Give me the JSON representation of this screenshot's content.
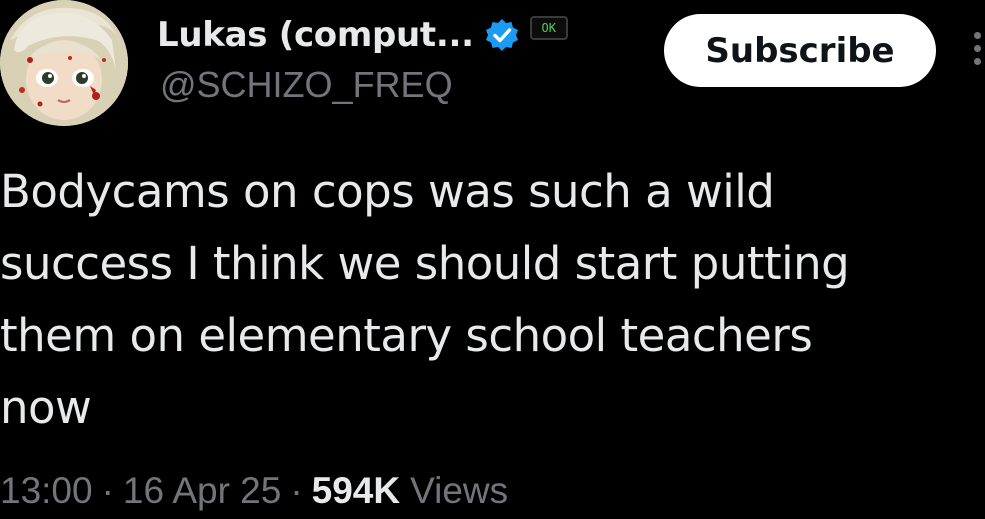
{
  "author": {
    "display_name": "Lukas (comput...",
    "handle": "@SCHIZO_FREQ",
    "badge_verified_icon": "verified-check-icon",
    "badge_ok_label": "OK",
    "avatar_icon": "anime-avatar-image"
  },
  "actions": {
    "subscribe_label": "Subscribe",
    "more_icon": "more-vertical-icon"
  },
  "tweet": {
    "lines": [
      "Bodycams on cops was such a wild",
      "success I think we should start putting",
      "them on elementary school teachers",
      "now"
    ]
  },
  "meta": {
    "time": "13:00",
    "separator": "·",
    "date": "16 Apr 25",
    "views_count": "594K",
    "views_label": "Views"
  },
  "colors": {
    "background": "#000000",
    "text_primary": "#e7e9ea",
    "text_secondary": "#71767b",
    "verified_blue": "#1d9bf0",
    "ok_green": "#4fd04f"
  }
}
